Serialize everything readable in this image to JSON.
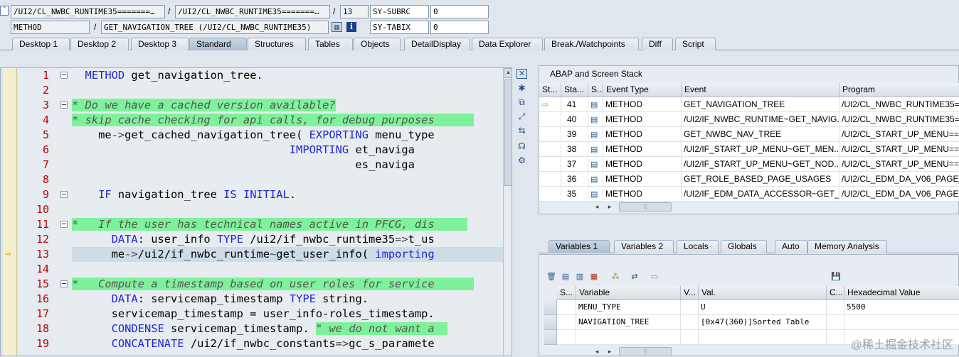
{
  "header": {
    "row1": {
      "field1": "/UI2/CL_NWBC_RUNTIME35=======…",
      "sep1": "/",
      "field2": "/UI2/CL_NWBC_RUNTIME35=======…",
      "sep2": "/",
      "line_no": "13",
      "sysvar": "SY-SUBRC",
      "sysval": "0"
    },
    "row2": {
      "field1": "METHOD",
      "sep1": "/",
      "field2": "GET_NAVIGATION_TREE (/UI2/CL_NWBC_RUNTIME35)",
      "sysvar": "SY-TABIX",
      "sysval": "0"
    }
  },
  "tabs": [
    "Desktop 1",
    "Desktop 2",
    "Desktop 3",
    "Standard",
    "Structures",
    "Tables",
    "Objects",
    "DetailDisplay",
    "Data Explorer",
    "Break./Watchpoints",
    "Diff",
    "Script"
  ],
  "active_tab": "Standard",
  "code": {
    "lines": [
      {
        "n": "1"
      },
      {
        "n": "2"
      },
      {
        "n": "3"
      },
      {
        "n": "4"
      },
      {
        "n": "5"
      },
      {
        "n": "6"
      },
      {
        "n": "7"
      },
      {
        "n": "8"
      },
      {
        "n": "9"
      },
      {
        "n": "10"
      },
      {
        "n": "11"
      },
      {
        "n": "12"
      },
      {
        "n": "13"
      },
      {
        "n": "14"
      },
      {
        "n": "15"
      },
      {
        "n": "16"
      },
      {
        "n": "17"
      },
      {
        "n": "18"
      },
      {
        "n": "19"
      }
    ]
  },
  "stack": {
    "title": "ABAP and Screen Stack",
    "columns": [
      "St...",
      "Sta...",
      "S...",
      "Event Type",
      "Event",
      "Program"
    ],
    "rows": [
      {
        "level": "41",
        "type": "METHOD",
        "event": "GET_NAVIGATION_TREE",
        "program": "/UI2/CL_NWBC_RUNTIME35=="
      },
      {
        "level": "40",
        "type": "METHOD",
        "event": "/UI2/IF_NWBC_RUNTIME~GET_NAVIG...",
        "program": "/UI2/CL_NWBC_RUNTIME35=="
      },
      {
        "level": "39",
        "type": "METHOD",
        "event": "GET_NWBC_NAV_TREE",
        "program": "/UI2/CL_START_UP_MENU=="
      },
      {
        "level": "38",
        "type": "METHOD",
        "event": "/UI2/IF_START_UP_MENU~GET_MEN...",
        "program": "/UI2/CL_START_UP_MENU=="
      },
      {
        "level": "37",
        "type": "METHOD",
        "event": "/UI2/IF_START_UP_MENU~GET_NOD...",
        "program": "/UI2/CL_START_UP_MENU=="
      },
      {
        "level": "36",
        "type": "METHOD",
        "event": "GET_ROLE_BASED_PAGE_USAGES",
        "program": "/UI2/CL_EDM_DA_V06_PAGE_"
      },
      {
        "level": "35",
        "type": "METHOD",
        "event": "/UI2/IF_EDM_DATA_ACCESSOR~GET_...",
        "program": "/UI2/CL_EDM_DA_V06_PAGE_"
      }
    ]
  },
  "vartabs": [
    "Variables 1",
    "Variables 2",
    "Locals",
    "Globals",
    "Auto",
    "Memory Analysis"
  ],
  "variables": {
    "columns": [
      "S...",
      "Variable",
      "V...",
      "Val.",
      "C...",
      "Hexadecimal Value"
    ],
    "rows": [
      {
        "name": "MENU_TYPE",
        "val": "U",
        "hex": "5500"
      },
      {
        "name": "NAVIGATION_TREE",
        "val": "[0x47(360)]Sorted Table",
        "hex": ""
      },
      {
        "name": "",
        "val": "",
        "hex": ""
      }
    ]
  },
  "watermark": "@稀土掘金技术社区",
  "colors": {
    "comment_bg": "#7ef29a",
    "keyword": "#1e27d6",
    "line_number": "#c00000"
  }
}
